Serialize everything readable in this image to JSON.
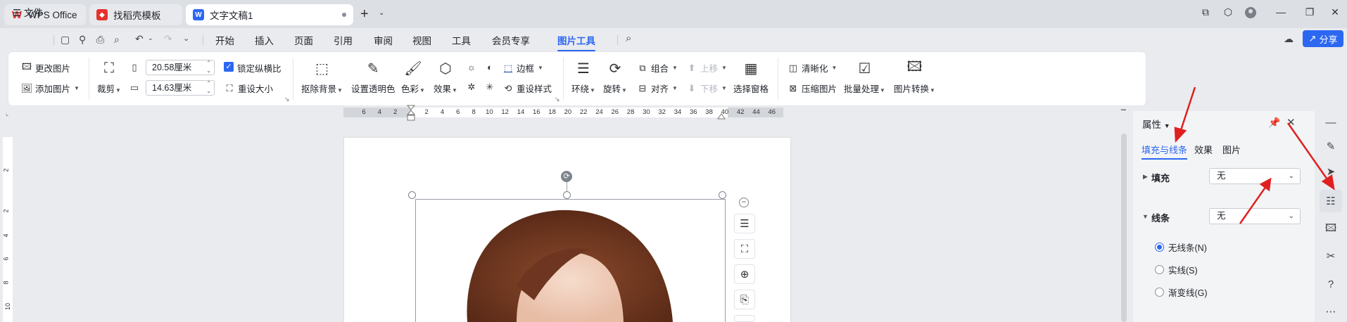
{
  "tabs": [
    {
      "label": "WPS Office",
      "logo": "wps-logo-icon"
    },
    {
      "label": "找稻壳模板",
      "logo": "template-logo-icon"
    },
    {
      "label": "文字文稿1",
      "logo": "writer-doc-icon"
    }
  ],
  "menu": {
    "file": "文件",
    "items": [
      "开始",
      "插入",
      "页面",
      "引用",
      "审阅",
      "视图",
      "工具",
      "会员专享",
      "图片工具"
    ],
    "active": "图片工具",
    "share": "分享"
  },
  "ribbon": {
    "change_picture": "更改图片",
    "add_picture": "添加图片",
    "crop": "裁剪",
    "width_value": "20.58厘米",
    "height_value": "14.63厘米",
    "lock_ratio": "锁定纵横比",
    "reset_size": "重设大小",
    "remove_background": "抠除背景",
    "set_transparent": "设置透明色",
    "color": "色彩",
    "effects": "效果",
    "border": "边框",
    "reset_style": "重设样式",
    "wrap": "环绕",
    "rotate": "旋转",
    "group": "组合",
    "align": "对齐",
    "move_up": "上移",
    "move_down": "下移",
    "selection_pane": "选择窗格",
    "sharpen": "清晰化",
    "compress_picture": "压缩图片",
    "batch_process": "批量处理",
    "picture_convert": "图片转换"
  },
  "ruler": {
    "h_ticks": [
      "6",
      "4",
      "2",
      "",
      "2",
      "4",
      "6",
      "8",
      "10",
      "12",
      "14",
      "16",
      "18",
      "20",
      "22",
      "24",
      "26",
      "28",
      "30",
      "32",
      "34",
      "36",
      "38",
      "40",
      "42",
      "44",
      "46"
    ],
    "v_ticks": [
      "2",
      "2",
      "4",
      "6",
      "8",
      "10"
    ]
  },
  "panel": {
    "title": "属性",
    "tabs": [
      "填充与线条",
      "效果",
      "图片"
    ],
    "active_tab": "填充与线条",
    "fill_label": "填充",
    "fill_value": "无",
    "line_label": "线条",
    "line_value": "无",
    "line_options": [
      {
        "label": "无线条(N)",
        "selected": true
      },
      {
        "label": "实线(S)",
        "selected": false
      },
      {
        "label": "渐变线(G)",
        "selected": false
      }
    ]
  },
  "colors": {
    "accent": "#2c67f2",
    "annotation_arrow": "#e02020"
  }
}
